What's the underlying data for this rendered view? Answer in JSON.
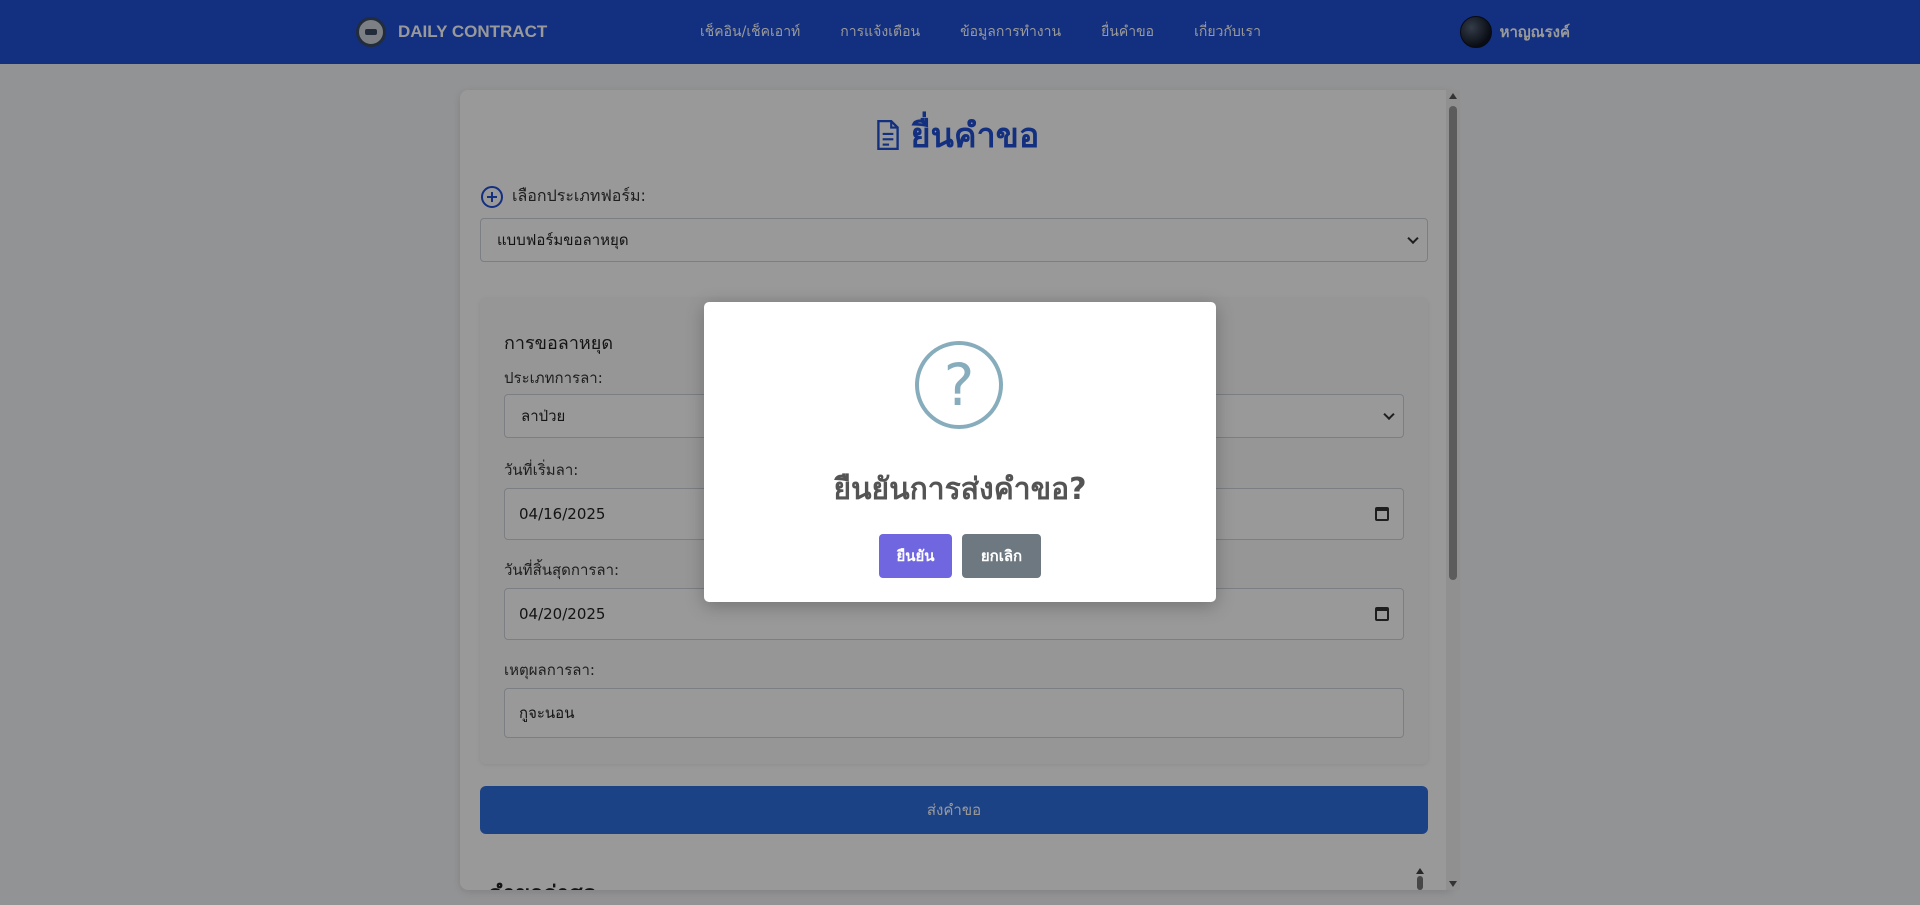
{
  "navbar": {
    "brand": "DAILY CONTRACT",
    "links": [
      "เช็คอิน/เช็คเอาท์",
      "การแจ้งเตือน",
      "ข้อมูลการทำงาน",
      "ยื่นคำขอ",
      "เกี่ยวกับเรา"
    ],
    "user_name": "หาญณรงค์"
  },
  "page": {
    "title": "ยื่นคำขอ",
    "form_type_label": "เลือกประเภทฟอร์ม:",
    "form_type_value": "แบบฟอร์มขอลาหยุด",
    "section_title": "การขอลาหยุด",
    "leave_type_label": "ประเภทการลา:",
    "leave_type_value": "ลาป่วย",
    "start_label": "วันที่เริ่มลา:",
    "start_value": "04/16/2025",
    "end_label": "วันที่สิ้นสุดการลา:",
    "end_value": "04/20/2025",
    "reason_label": "เหตุผลการลา:",
    "reason_value": "กูจะนอน",
    "submit_label": "ส่งคำขอ",
    "latest_heading": "คำขอล่าสุด"
  },
  "modal": {
    "icon": "?",
    "title": "ยืนยันการส่งคำขอ?",
    "confirm_label": "ยืนยัน",
    "cancel_label": "ยกเลิก"
  },
  "colors": {
    "navbar": "#1e4fd6",
    "confirm": "#7066e0",
    "cancel": "#6e7881",
    "question_icon": "#87adbd"
  }
}
